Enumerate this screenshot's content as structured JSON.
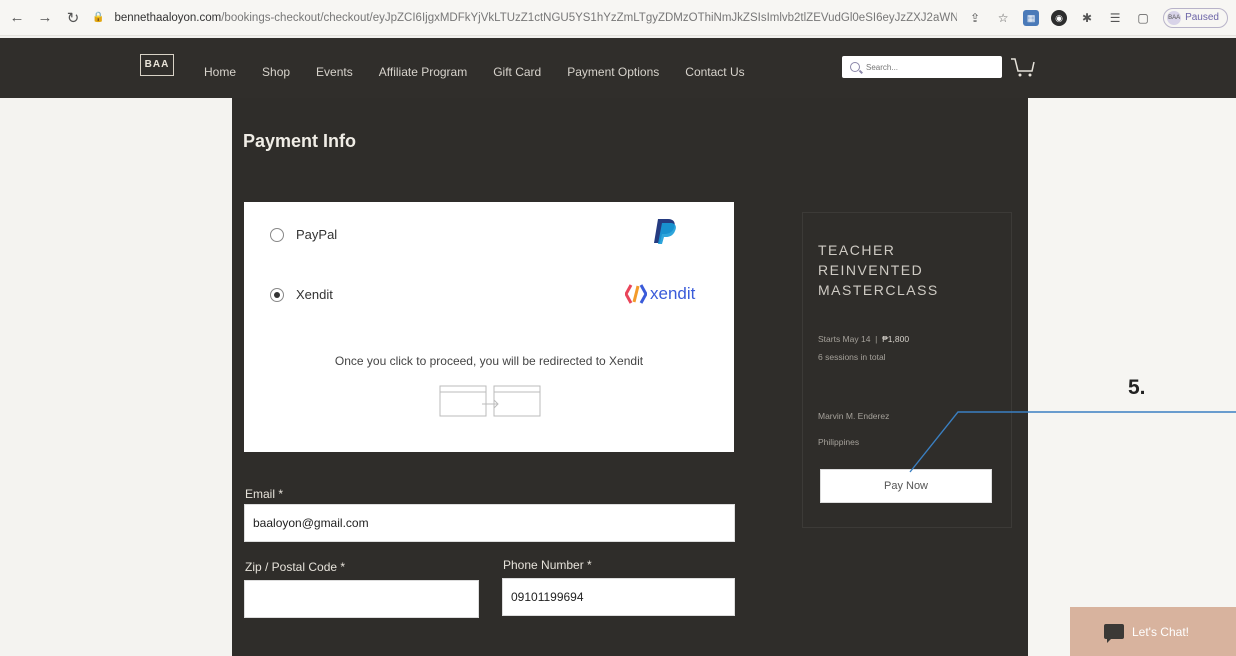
{
  "browser": {
    "url_domain": "bennethaaloyon.com",
    "url_path": "/bookings-checkout/checkout/eyJpZCI6IjgxMDFkYjVkLTUzZ1ctNGU5YS1hYzZmLTgyZDMzOThiNmJkZSIsImlvb2tlZEVudGl0eSI6eyJzZXJ2aWNlSW...",
    "profile_label": "Paused",
    "profile_initials": "BAA"
  },
  "header": {
    "logo_text": "BAA",
    "nav_items": [
      "Home",
      "Shop",
      "Events",
      "Affiliate Program",
      "Gift Card",
      "Payment Options",
      "Contact Us"
    ],
    "search_placeholder": "Search..."
  },
  "payment": {
    "title": "Payment Info",
    "options": [
      {
        "label": "PayPal",
        "selected": false,
        "logo": "paypal-icon"
      },
      {
        "label": "Xendit",
        "selected": true,
        "logo": "xendit-icon"
      }
    ],
    "xendit_wordmark": "xendit",
    "redirect_note": "Once you click to proceed, you will be redirected to Xendit"
  },
  "form": {
    "email_label": "Email *",
    "email_value": "baaloyon@gmail.com",
    "zip_label": "Zip / Postal Code *",
    "zip_value": "",
    "phone_label": "Phone Number *",
    "phone_value": "09101199694"
  },
  "card": {
    "title_lines": [
      "TEACHER",
      "REINVENTED",
      "MASTERCLASS"
    ],
    "starts": "Starts May 14",
    "price": "₱1,800",
    "sessions": "6 sessions in total",
    "instructor": "Marvin M. Enderez",
    "location": "Philippines",
    "pay_button": "Pay Now"
  },
  "annotation": {
    "step": "5."
  },
  "chat": {
    "label": "Let's Chat!"
  },
  "colors": {
    "header_bg": "#302e2b",
    "main_bg": "#2f2d2a",
    "chat_bg": "#d8b39e",
    "xendit_blue": "#3a5bd9",
    "annotation_line": "#3a7fc1"
  }
}
